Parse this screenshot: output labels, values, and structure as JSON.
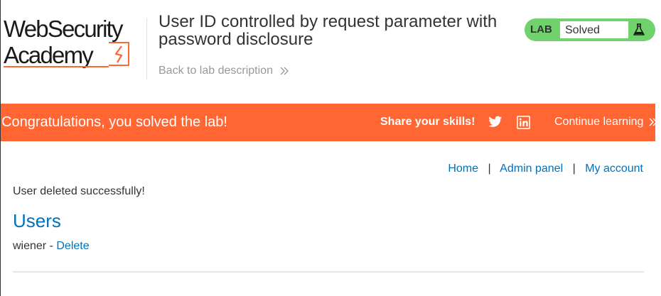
{
  "header": {
    "logo_line1": "WebSecurity",
    "logo_line2": "Academy",
    "lab_title": "User ID controlled by request parameter with password disclosure",
    "back_link": "Back to lab description"
  },
  "status": {
    "lab_label": "LAB",
    "state": "Solved",
    "icon": "flask-icon",
    "color": "#70d16d"
  },
  "banner": {
    "message": "Congratulations, you solved the lab!",
    "share_label": "Share your skills!",
    "twitter_icon": "twitter-icon",
    "linkedin_icon": "linkedin-icon",
    "continue_label": "Continue learning",
    "color": "#ff6633"
  },
  "nav": {
    "home": "Home",
    "separator": "|",
    "admin_panel": "Admin panel",
    "my_account": "My account"
  },
  "content": {
    "message": "User deleted successfully!",
    "heading": "Users",
    "users": [
      {
        "name": "wiener",
        "separator": " - ",
        "action": "Delete"
      }
    ]
  },
  "colors": {
    "link": "#0071bc",
    "text": "#333333"
  }
}
